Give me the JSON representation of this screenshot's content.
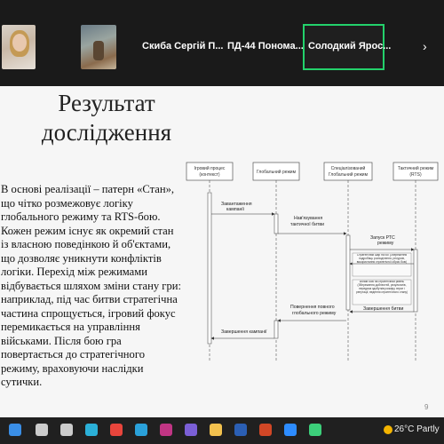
{
  "zoom": {
    "participants": [
      {
        "name": "Скиба Сергій П..."
      },
      {
        "name": "ПД-44 Понома..."
      }
    ],
    "active_participant": "Солодкий Ярос...",
    "next_arrow": "›"
  },
  "slide": {
    "title_line1": "Результат",
    "title_line2": "дослідження",
    "body": "В основі реалізації – патерн «Стан», що чітко розмежовує логіку глобального режиму та RTS-бою. Кожен режим існує як окремий стан із власною поведінкою й об'єктами, що дозволяє уникнути конфліктів логіки. Перехід між режимами відбувається шляхом зміни стану гри: наприклад, під час битви стратегічна частина спрощується, ігровий фокус перемикається на управління військами. Після бою гра повертається до стратегічного режиму, враховуючи наслідки сутички.",
    "page_number": "9"
  },
  "diagram": {
    "lifelines": [
      {
        "label1": "Ігровий процес",
        "label2": "(контекст)"
      },
      {
        "label1": "Глобальний режим",
        "label2": ""
      },
      {
        "label1": "Спеціалізований",
        "label2": "Глобальний режим"
      },
      {
        "label1": "Тактичний режим",
        "label2": "(RTS)"
      }
    ],
    "messages": {
      "m1_line1": "Завантаження",
      "m1_line2": "кампанії",
      "m2_line1": "Нав'язування",
      "m2_line2": "тактичної битви",
      "m3_line1": "Запуск РТС",
      "m3_line2": "режиму",
      "note1": "Стратегічний шар на бої (Збереження подробиць розподілення, ресурсів, використання стратегічної обрис бою)",
      "note2": "Вплив бою на стратегічний рівень (Збереження доблестей, результатів, передача здобутків розміру, втрат і репутації, ведення стратегічного стану)",
      "m4": "Завершення битви",
      "m5_line1": "Повернення повного",
      "m5_line2": "глобального режиму",
      "m6": "Завершення кампанії"
    }
  },
  "taskbar": {
    "weather": "26°C  Partly",
    "icons": [
      {
        "name": "start-icon",
        "color": "#3a8ee6"
      },
      {
        "name": "search-icon",
        "color": "#cccccc"
      },
      {
        "name": "task-view-icon",
        "color": "#cccccc"
      },
      {
        "name": "edge-icon",
        "color": "#2bb0d8"
      },
      {
        "name": "chrome-icon",
        "color": "#e8453c"
      },
      {
        "name": "telegram-icon",
        "color": "#2aa1da"
      },
      {
        "name": "instagram-icon",
        "color": "#c13584"
      },
      {
        "name": "viber-icon",
        "color": "#7b5fd6"
      },
      {
        "name": "folder-icon",
        "color": "#f2c14e"
      },
      {
        "name": "word-icon",
        "color": "#2b5fb4"
      },
      {
        "name": "powerpoint-icon",
        "color": "#d24726"
      },
      {
        "name": "zoom-icon",
        "color": "#2d8cff"
      },
      {
        "name": "app-icon",
        "color": "#3ccf7a"
      }
    ]
  }
}
